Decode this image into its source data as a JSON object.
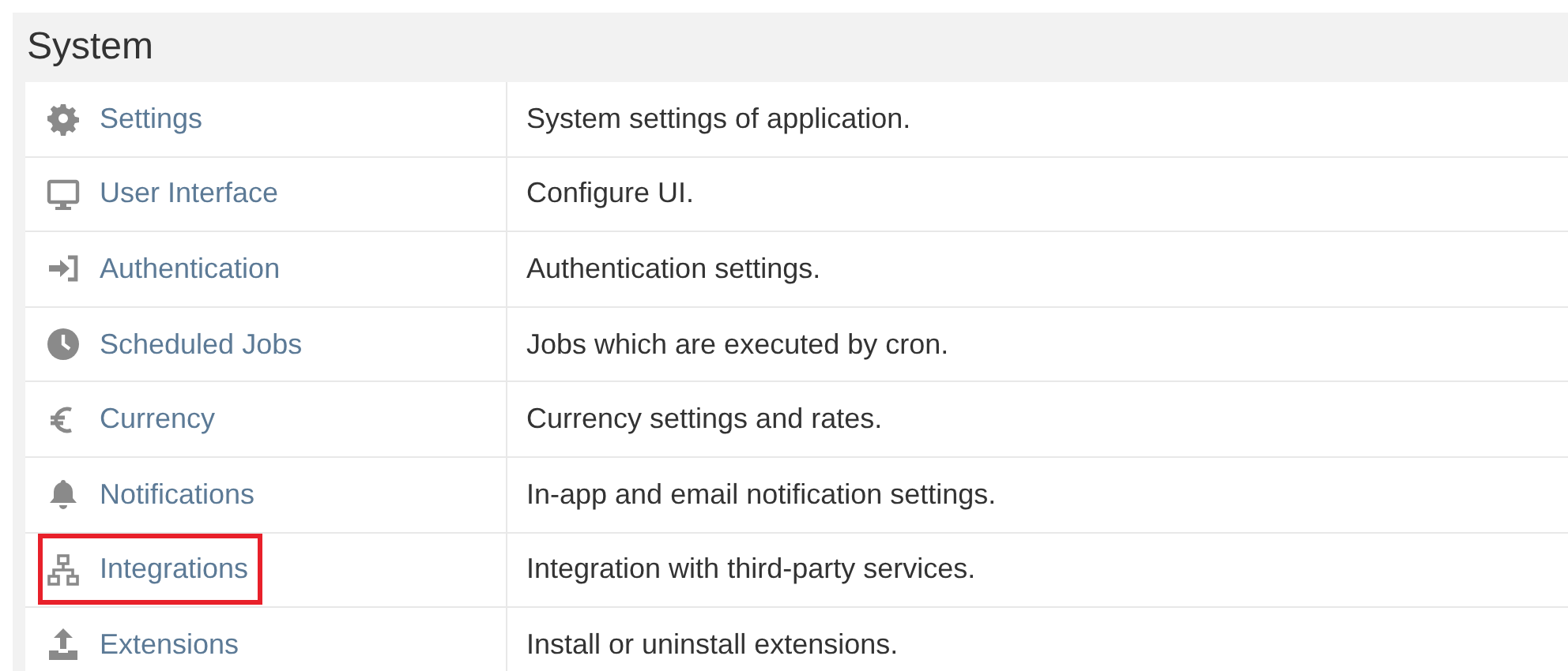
{
  "panel": {
    "title": "System"
  },
  "rows": [
    {
      "kind": "gear",
      "label": "Settings",
      "description": "System settings of application.",
      "highlighted": false
    },
    {
      "kind": "monitor",
      "label": "User Interface",
      "description": "Configure UI.",
      "highlighted": false
    },
    {
      "kind": "signin",
      "label": "Authentication",
      "description": "Authentication settings.",
      "highlighted": false
    },
    {
      "kind": "clock",
      "label": "Scheduled Jobs",
      "description": "Jobs which are executed by cron.",
      "highlighted": false
    },
    {
      "kind": "euro",
      "label": "Currency",
      "description": "Currency settings and rates.",
      "highlighted": false
    },
    {
      "kind": "bell",
      "label": "Notifications",
      "description": "In-app and email notification settings.",
      "highlighted": false
    },
    {
      "kind": "network",
      "label": "Integrations",
      "description": "Integration with third-party services.",
      "highlighted": true
    },
    {
      "kind": "upload",
      "label": "Extensions",
      "description": "Install or uninstall extensions.",
      "highlighted": false
    }
  ]
}
